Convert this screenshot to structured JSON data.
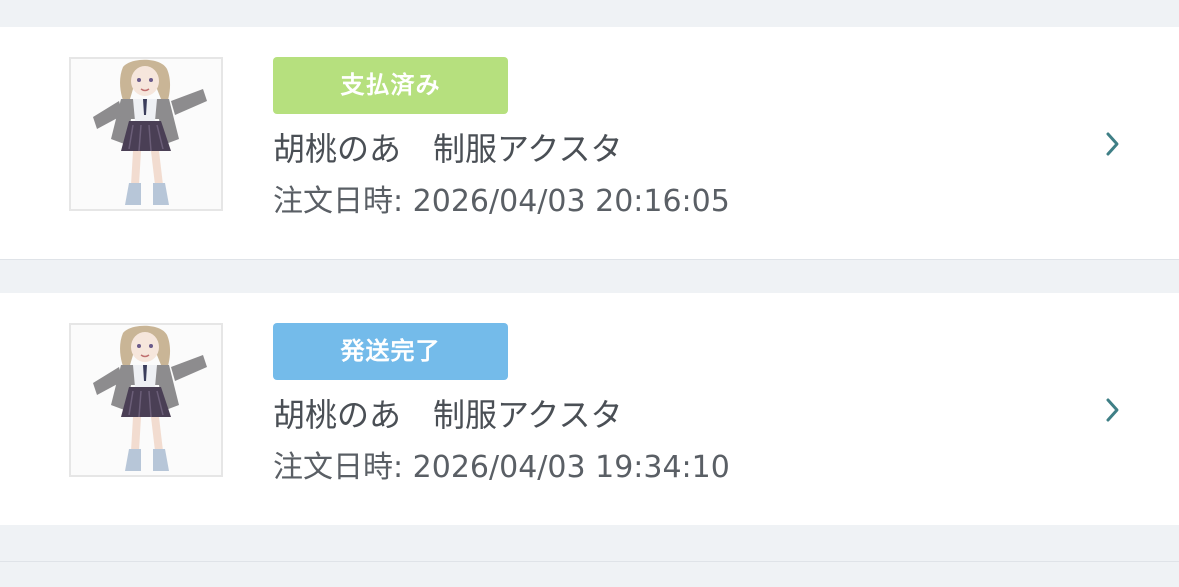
{
  "orders": [
    {
      "status": "支払済み",
      "status_color": "#b6e07e",
      "product_name": "胡桃のあ　制服アクスタ",
      "order_date_label": "注文日時:",
      "order_date": "2026/04/03 20:16:05",
      "thumbnail": "character-thumbnail",
      "arrow_icon": "chevron-right-icon"
    },
    {
      "status": "発送完了",
      "status_color": "#74bbea",
      "product_name": "胡桃のあ　制服アクスタ",
      "order_date_label": "注文日時:",
      "order_date": "2026/04/03 19:34:10",
      "thumbnail": "character-thumbnail",
      "arrow_icon": "chevron-right-icon"
    }
  ],
  "colors": {
    "background": "#eff2f5",
    "card": "#ffffff",
    "text": "#4a4f55",
    "chevron": "#3f7f86"
  }
}
